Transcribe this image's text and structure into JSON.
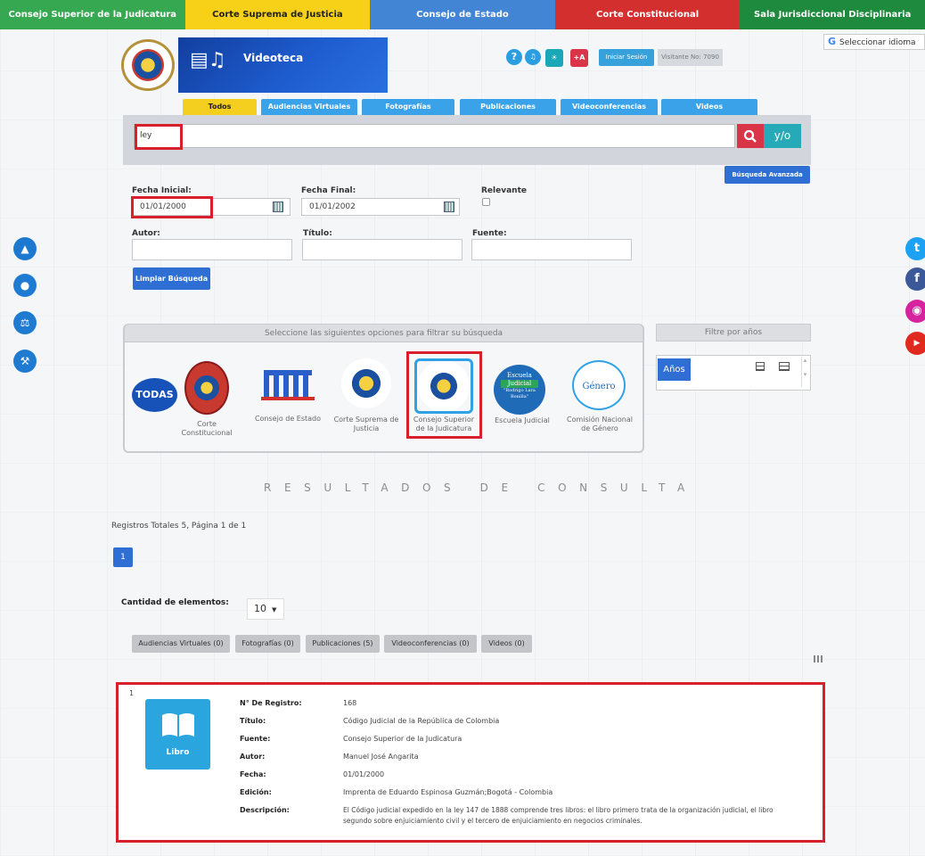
{
  "topnav": [
    {
      "label": "Consejo Superior de la Judicatura",
      "color": "#36a852"
    },
    {
      "label": "Corte Suprema de Justicia",
      "color": "#f7d117"
    },
    {
      "label": "Consejo de Estado",
      "color": "#4285d4"
    },
    {
      "label": "Corte Constitucional",
      "color": "#d32f2f"
    },
    {
      "label": "Sala Jurisdiccional Disciplinaria",
      "color": "#1e8a3e"
    }
  ],
  "header": {
    "banner_title": "Videoteca",
    "help_icon": "help-icon",
    "volume_icon": "volume-icon",
    "light_icon": "lightbulb-icon",
    "font_increase": "+A",
    "login_label": "Iniciar Sesión",
    "visitor_text": "Visitante No: 7090",
    "language_label": "Seleccionar idioma"
  },
  "tabs": [
    "Todos",
    "Audiencias Virtuales",
    "Fotografías",
    "Publicaciones",
    "Videoconferencias",
    "Videos"
  ],
  "search": {
    "query": "ley",
    "yo_label": "y/o",
    "advanced_label": "Búsqueda Avanzada"
  },
  "filters": {
    "fecha_inicial_label": "Fecha Inicial:",
    "fecha_inicial_value": "01/01/2000",
    "fecha_final_label": "Fecha Final:",
    "fecha_final_value": "01/01/2002",
    "relevante_label": "Relevante",
    "autor_label": "Autor:",
    "titulo_label": "Título:",
    "fuente_label": "Fuente:",
    "clear_label": "Limpiar Búsqueda"
  },
  "entity_filter": {
    "heading": "Seleccione las siguientes opciones para filtrar su búsqueda",
    "todas_label": "TODAS",
    "entities": [
      {
        "line1": "Corte",
        "line2": "Constitucional"
      },
      {
        "line1": "Consejo de Estado",
        "line2": ""
      },
      {
        "line1": "Corte Suprema de",
        "line2": "Justicia"
      },
      {
        "line1": "Consejo Superior",
        "line2": "de la Judicatura"
      },
      {
        "line1": "Escuela Judicial",
        "line2": ""
      },
      {
        "line1": "Comisión Nacional",
        "line2": "de Género"
      }
    ],
    "escuela_logo_lines": [
      "Escuela",
      "Judicial",
      "\"Rodrigo Lara",
      "Bonilla\""
    ],
    "genero_logo_text": "Género"
  },
  "years": {
    "heading": "Filtre por años",
    "button_label": "Años"
  },
  "results": {
    "title": "RESULTADOS DE CONSULTA",
    "registros_text": "Registros Totales 5, Página 1 de 1",
    "page_number": "1",
    "cantidad_label": "Cantidad de elementos:",
    "cantidad_value": "10",
    "category_tabs": [
      "Audiencias Virtuales (0)",
      "Fotografías (0)",
      "Publicaciones (5)",
      "Videoconferencias (0)",
      "Videos (0)"
    ]
  },
  "record": {
    "index": "1",
    "type_label": "Libro",
    "fields": [
      {
        "key": "N° De Registro:",
        "value": "168"
      },
      {
        "key": "Título:",
        "value": "Código Judicial de la República de Colombia"
      },
      {
        "key": "Fuente:",
        "value": "Consejo Superior de la Judicatura"
      },
      {
        "key": "Autor:",
        "value": "Manuel José Angarita"
      },
      {
        "key": "Fecha:",
        "value": "01/01/2000"
      },
      {
        "key": "Edición:",
        "value": "Imprenta de Eduardo Espinosa Guzmán;Bogotá - Colombia"
      }
    ],
    "descripcion_label": "Descripción:",
    "descripcion_line1": "El Código judicial expedido en la ley 147 de 1888 comprende tres libros: el libro primero trata de la organización judicial, el libro",
    "descripcion_line2": "segundo sobre enjuiciamiento civil y el tercero de enjuiciamiento en negocios criminales."
  },
  "social": [
    {
      "name": "twitter-icon",
      "color": "#1da1f2"
    },
    {
      "name": "facebook-icon",
      "color": "#3b5998"
    },
    {
      "name": "instagram-icon",
      "color": "#d6249f"
    },
    {
      "name": "youtube-icon",
      "color": "#e02a20"
    }
  ]
}
